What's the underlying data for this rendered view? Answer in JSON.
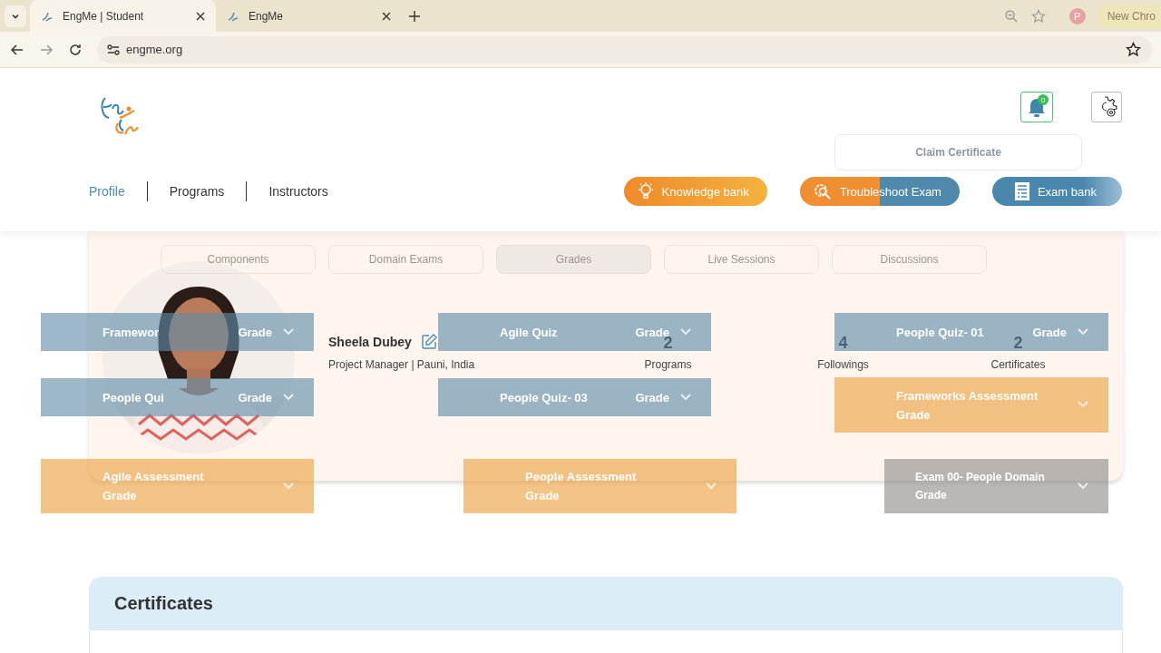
{
  "browser": {
    "tabs": [
      {
        "title": "EngMe | Student",
        "selected": true
      },
      {
        "title": "EngMe",
        "selected": false
      }
    ],
    "address": "engme.org",
    "profile_initial": "P",
    "side_button": "New Chro"
  },
  "header": {
    "notification_count": "0",
    "nav": [
      {
        "label": "Profile",
        "selected": true
      },
      {
        "label": "Programs",
        "selected": false
      },
      {
        "label": "Instructors",
        "selected": false
      }
    ],
    "buttons": [
      {
        "label": "Knowledge bank",
        "kind": "knowledge"
      },
      {
        "label": "Troubleshoot Exam",
        "kind": "troubleshoot"
      },
      {
        "label": "Exam bank",
        "kind": "exam"
      }
    ]
  },
  "faded_previous_page": {
    "claim_button": "Claim Certificate",
    "tabs": [
      {
        "label": "Components",
        "selected": false
      },
      {
        "label": "Domain Exams",
        "selected": false
      },
      {
        "label": "Grades",
        "selected": true
      },
      {
        "label": "Live Sessions",
        "selected": false
      },
      {
        "label": "Discussions",
        "selected": false
      }
    ],
    "grade_tiles": [
      {
        "title": "Framewor",
        "grade": "Grade",
        "kind": "quiz"
      },
      {
        "title": "People Qui",
        "grade": "Grade",
        "kind": "quiz"
      },
      {
        "title": "Agile Quiz",
        "grade": "Grade",
        "kind": "quiz"
      },
      {
        "title": "People Quiz- 03",
        "grade": "Grade",
        "kind": "quiz"
      },
      {
        "title": "People Quiz- 01",
        "grade": "Grade",
        "kind": "quiz"
      },
      {
        "title": "Frameworks Assessment",
        "grade": "Grade",
        "kind": "assessment"
      },
      {
        "title": "Agile Assessment",
        "grade": "Grade",
        "kind": "assessment"
      },
      {
        "title": "People Assessment",
        "grade": "Grade",
        "kind": "assessment"
      },
      {
        "title": "Exam 00- People Domain",
        "grade": "Grade",
        "kind": "exam"
      }
    ]
  },
  "profile": {
    "name": "Sheela Dubey",
    "subtitle": "Project Manager | Pauni, India",
    "stats": [
      {
        "value": "2",
        "label": "Programs"
      },
      {
        "value": "4",
        "label": "Followings"
      },
      {
        "value": "2",
        "label": "Certificates"
      }
    ]
  },
  "certificates": {
    "title": "Certificates"
  }
}
